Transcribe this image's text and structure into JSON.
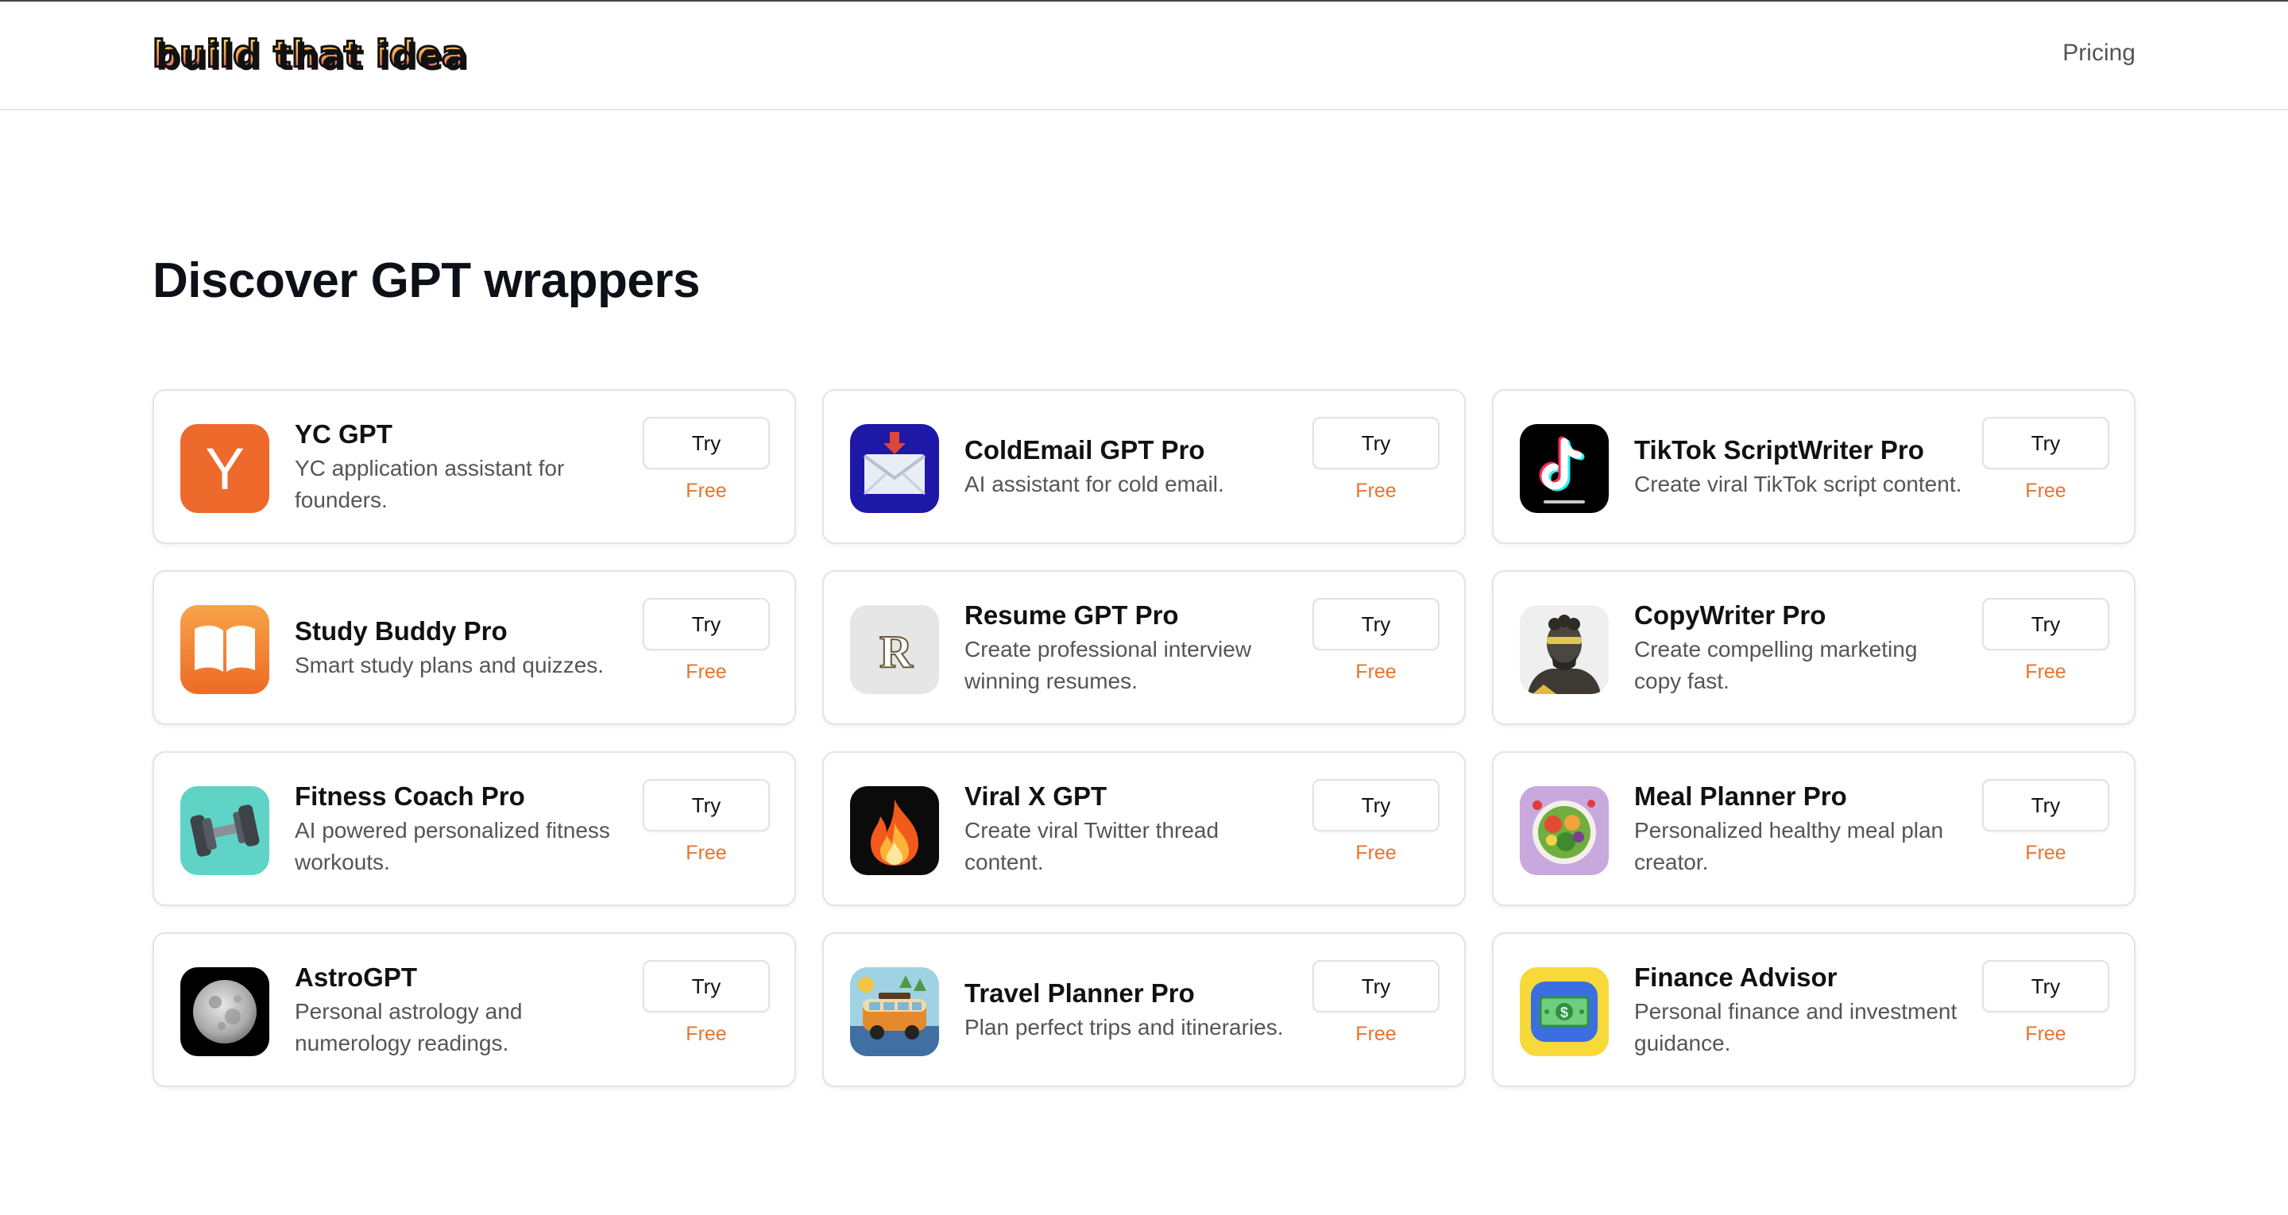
{
  "header": {
    "logo_text": "build that idea",
    "nav_pricing": "Pricing"
  },
  "main": {
    "title": "Discover GPT wrappers"
  },
  "colors": {
    "accent_orange": "#e8742a",
    "text_primary": "#111111",
    "text_secondary": "#555555"
  },
  "apps": [
    {
      "name": "YC GPT",
      "description": "YC application assistant for founders.",
      "action": "Try",
      "price": "Free",
      "icon": "yc-logo-icon"
    },
    {
      "name": "ColdEmail GPT Pro",
      "description": "AI assistant for cold email.",
      "action": "Try",
      "price": "Free",
      "icon": "envelope-icon"
    },
    {
      "name": "TikTok ScriptWriter Pro",
      "description": "Create viral TikTok script content.",
      "action": "Try",
      "price": "Free",
      "icon": "tiktok-icon"
    },
    {
      "name": "Study Buddy Pro",
      "description": "Smart study plans and quizzes.",
      "action": "Try",
      "price": "Free",
      "icon": "open-book-icon"
    },
    {
      "name": "Resume GPT Pro",
      "description": "Create professional interview winning resumes.",
      "action": "Try",
      "price": "Free",
      "icon": "letter-r-icon"
    },
    {
      "name": "CopyWriter Pro",
      "description": "Create compelling marketing copy fast.",
      "action": "Try",
      "price": "Free",
      "icon": "statue-bust-icon"
    },
    {
      "name": "Fitness Coach Pro",
      "description": "AI powered personalized fitness workouts.",
      "action": "Try",
      "price": "Free",
      "icon": "dumbbell-icon"
    },
    {
      "name": "Viral X GPT",
      "description": "Create viral Twitter thread content.",
      "action": "Try",
      "price": "Free",
      "icon": "fire-icon"
    },
    {
      "name": "Meal Planner Pro",
      "description": "Personalized healthy meal plan creator.",
      "action": "Try",
      "price": "Free",
      "icon": "salad-bowl-icon"
    },
    {
      "name": "AstroGPT",
      "description": "Personal astrology and numerology readings.",
      "action": "Try",
      "price": "Free",
      "icon": "moon-icon"
    },
    {
      "name": "Travel Planner Pro",
      "description": "Plan perfect trips and itineraries.",
      "action": "Try",
      "price": "Free",
      "icon": "travel-van-icon"
    },
    {
      "name": "Finance Advisor",
      "description": "Personal finance and investment guidance.",
      "action": "Try",
      "price": "Free",
      "icon": "money-bill-icon"
    }
  ]
}
